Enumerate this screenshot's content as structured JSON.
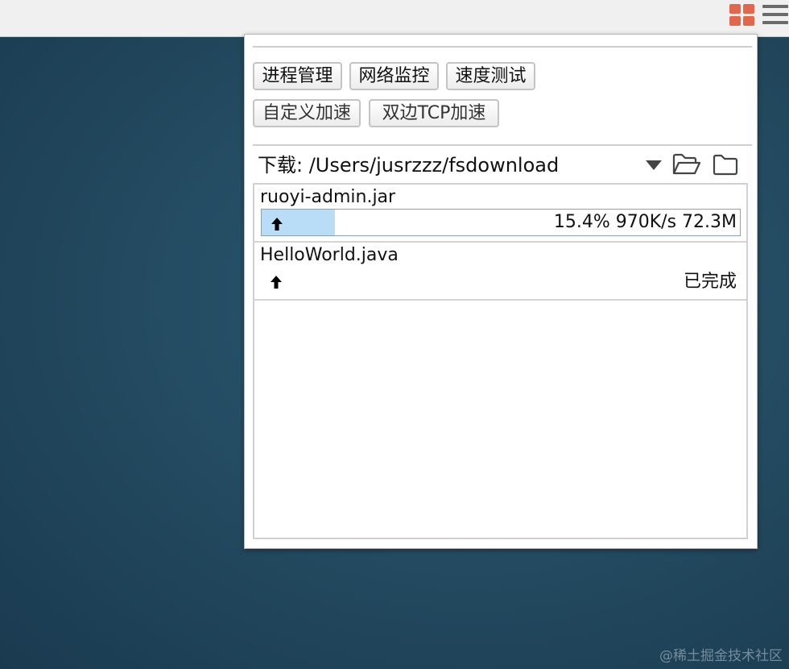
{
  "toolbar_icons": {
    "apps": "apps-grid-icon",
    "menu": "hamburger-menu-icon",
    "apps_color": "#e2674b"
  },
  "buttons": {
    "process_manager": "进程管理",
    "network_monitor": "网络监控",
    "speed_test": "速度测试",
    "custom_accel": "自定义加速",
    "bilateral_tcp_accel": "双边TCP加速"
  },
  "download": {
    "label": "下载: /Users/jusrzzz/fsdownload",
    "icons": [
      "dropdown-arrow-icon",
      "open-folder-icon",
      "folder-icon"
    ]
  },
  "items": [
    {
      "name": "ruoyi-admin.jar",
      "direction": "upload",
      "progress_fraction": 0.154,
      "stats": "15.4% 970K/s 72.3M"
    },
    {
      "name": "HelloWorld.java",
      "direction": "upload",
      "status": "已完成"
    }
  ],
  "colors": {
    "progress_fill": "#b9dcf7",
    "background": "#244c63"
  },
  "watermark": "@稀土掘金技术社区"
}
